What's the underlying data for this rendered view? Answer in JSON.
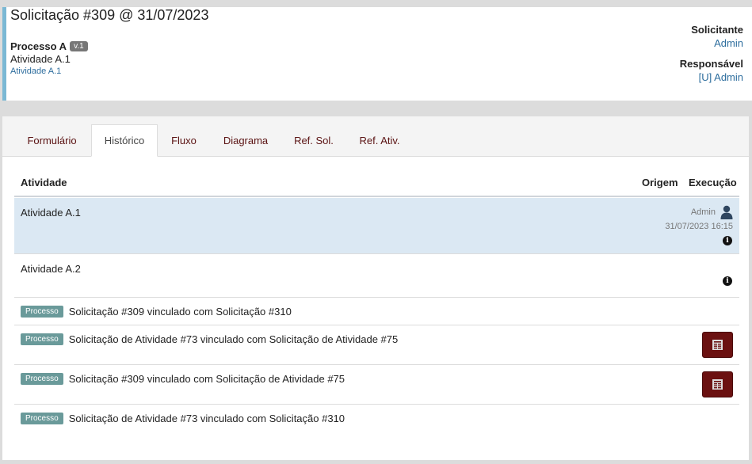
{
  "header": {
    "title": "Solicitação #309 @ 31/07/2023",
    "process_name": "Processo A",
    "version": "v.1",
    "activity": "Atividade A.1",
    "activity_link": "Atividade A.1",
    "requester_label": "Solicitante",
    "requester": "Admin",
    "responsible_label": "Responsável",
    "responsible": "[U] Admin"
  },
  "tabs": [
    {
      "label": "Formulário"
    },
    {
      "label": "Histórico"
    },
    {
      "label": "Fluxo"
    },
    {
      "label": "Diagrama"
    },
    {
      "label": "Ref. Sol."
    },
    {
      "label": "Ref. Ativ."
    }
  ],
  "active_tab": "Histórico",
  "table": {
    "headers": {
      "activity": "Atividade",
      "origin": "Origem",
      "execution": "Execução"
    },
    "rows": [
      {
        "activity": "Atividade A.1",
        "exec_user": "Admin",
        "exec_date": "31/07/2023 16:15"
      },
      {
        "activity": "Atividade A.2"
      }
    ],
    "links": [
      {
        "badge": "Processo",
        "text": "Solicitação #309 vinculado com Solicitação #310"
      },
      {
        "badge": "Processo",
        "text": "Solicitação de Atividade #73 vinculado com Solicitação de Atividade #75"
      },
      {
        "badge": "Processo",
        "text": "Solicitação #309 vinculado com Solicitação de Atividade #75"
      },
      {
        "badge": "Processo",
        "text": "Solicitação de Atividade #73 vinculado com Solicitação #310"
      }
    ]
  },
  "colors": {
    "accent": "#7ab8d4",
    "link": "#2e6e9e",
    "tab_text": "#5a1212",
    "button": "#6b1111",
    "badge": "#6a9a9a",
    "highlight": "#dbe8f3"
  }
}
